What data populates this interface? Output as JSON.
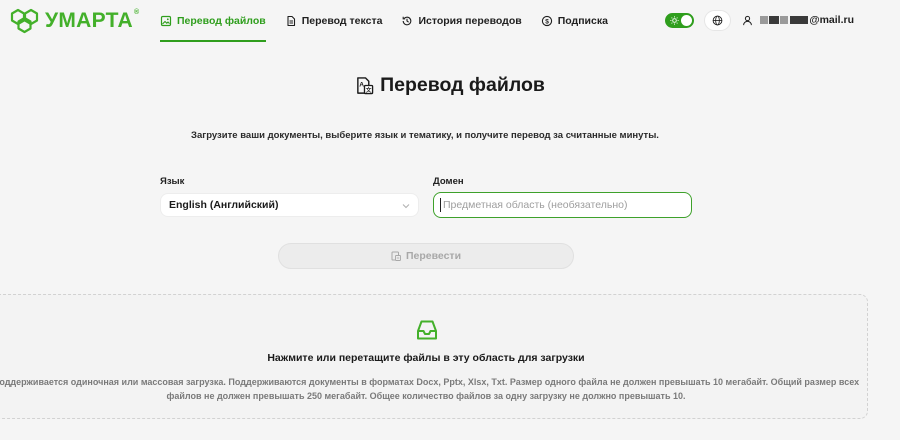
{
  "brand": {
    "name": "УМАРТА",
    "reg_mark": "®",
    "color": "#43b02a"
  },
  "nav": {
    "items": [
      {
        "label": "Перевод файлов",
        "icon": "file-image-icon",
        "active": true
      },
      {
        "label": "Перевод текста",
        "icon": "document-text-icon",
        "active": false
      },
      {
        "label": "История переводов",
        "icon": "history-icon",
        "active": false
      },
      {
        "label": "Подписка",
        "icon": "dollar-coin-icon",
        "active": false
      }
    ],
    "active_color": "#2f9e1d"
  },
  "header": {
    "theme_toggle": {
      "icon": "sun-icon",
      "on": true
    },
    "language_button_icon": "globe-icon",
    "user": {
      "icon": "user-icon",
      "email_visible_suffix": "@mail.ru"
    }
  },
  "page": {
    "title": "Перевод файлов",
    "title_icon": "translate-file-icon",
    "subtitle": "Загрузите ваши документы, выберите язык и тематику, и получите перевод за считанные минуты."
  },
  "form": {
    "language_label": "Язык",
    "language_value": "English (Английский)",
    "domain_label": "Домен",
    "domain_value": "",
    "domain_placeholder": "Предметная область (необязательно)",
    "submit_label": "Перевести",
    "submit_icon": "file-translate-icon",
    "submit_disabled": true
  },
  "dropzone": {
    "icon": "inbox-tray-icon",
    "title": "Нажмите или перетащите файлы в эту область для загрузки",
    "description": "Поддерживается одиночная или массовая загрузка. Поддерживаются документы в форматах Docx, Pptx, Xlsx, Txt. Размер одного файла не должен превышать 10 мегабайт. Общий размер всех файлов не должен превышать 250 мегабайт. Общее количество файлов за одну загрузку не должно превышать 10."
  }
}
